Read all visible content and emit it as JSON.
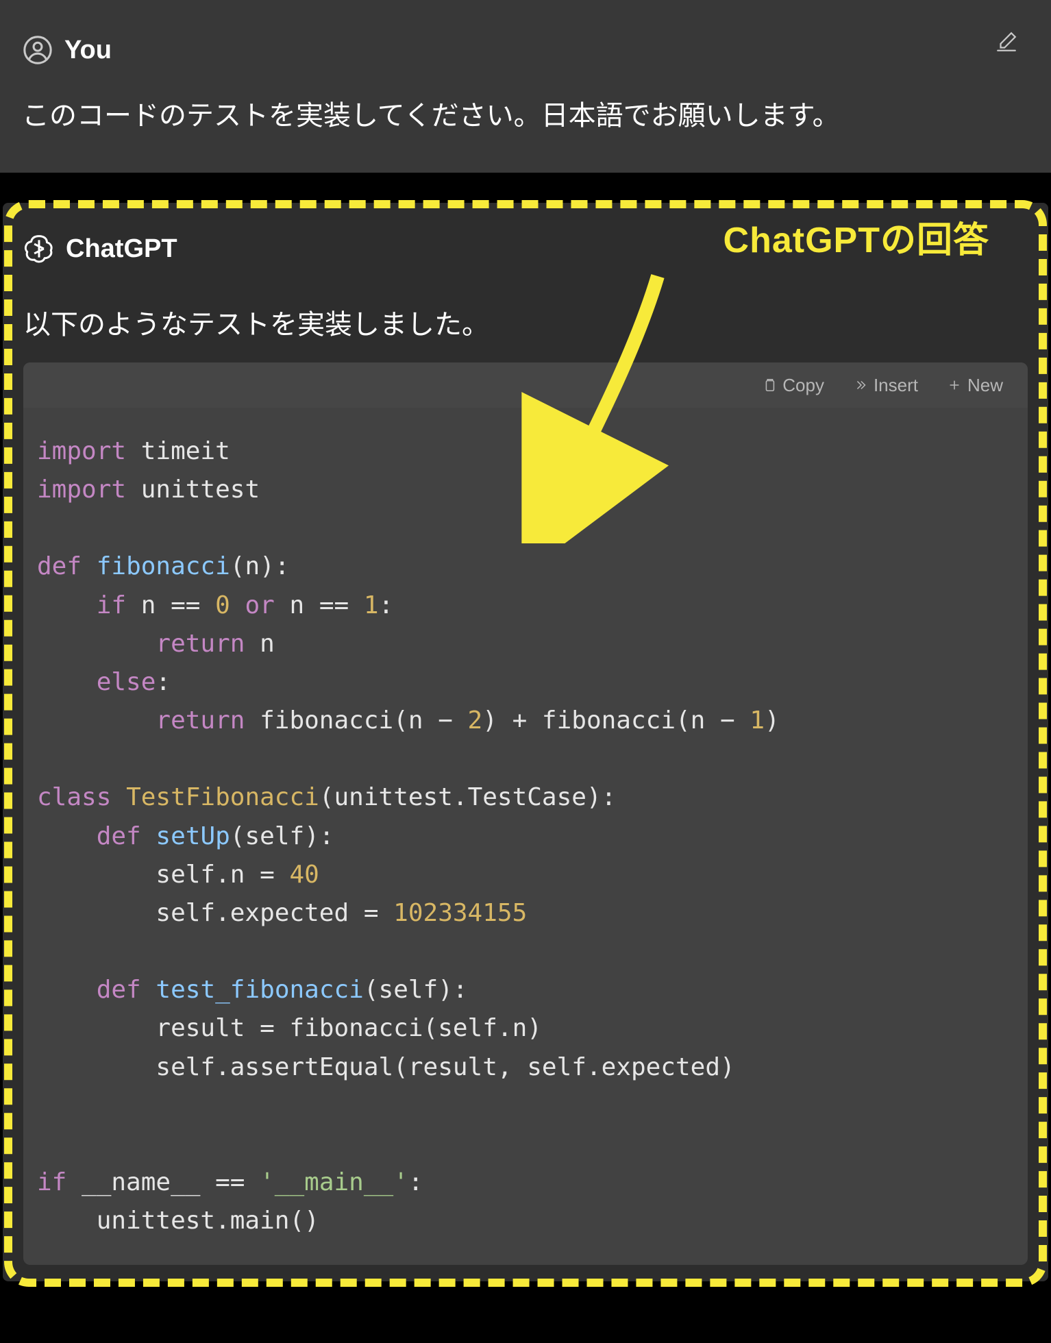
{
  "user": {
    "role": "You",
    "message": "このコードのテストを実装してください。日本語でお願いします。"
  },
  "assistant": {
    "role": "ChatGPT",
    "intro": "以下のようなテストを実装しました。"
  },
  "annotation": {
    "label": "ChatGPTの回答"
  },
  "toolbar": {
    "copy": "Copy",
    "insert": "Insert",
    "new": "New"
  },
  "code_tokens": [
    [
      [
        "kw",
        "import"
      ],
      [
        "p",
        " "
      ],
      [
        "id",
        "timeit"
      ]
    ],
    [
      [
        "kw",
        "import"
      ],
      [
        "p",
        " "
      ],
      [
        "id",
        "unittest"
      ]
    ],
    [],
    [
      [
        "kw",
        "def"
      ],
      [
        "p",
        " "
      ],
      [
        "fn",
        "fibonacci"
      ],
      [
        "p",
        "(n):"
      ]
    ],
    [
      [
        "p",
        "    "
      ],
      [
        "kw",
        "if"
      ],
      [
        "p",
        " n == "
      ],
      [
        "num",
        "0"
      ],
      [
        "p",
        " "
      ],
      [
        "kw",
        "or"
      ],
      [
        "p",
        " n == "
      ],
      [
        "num",
        "1"
      ],
      [
        "p",
        ":"
      ]
    ],
    [
      [
        "p",
        "        "
      ],
      [
        "kw",
        "return"
      ],
      [
        "p",
        " n"
      ]
    ],
    [
      [
        "p",
        "    "
      ],
      [
        "kw",
        "else"
      ],
      [
        "p",
        ":"
      ]
    ],
    [
      [
        "p",
        "        "
      ],
      [
        "kw",
        "return"
      ],
      [
        "p",
        " fibonacci(n − "
      ],
      [
        "num",
        "2"
      ],
      [
        "p",
        ") + fibonacci(n − "
      ],
      [
        "num",
        "1"
      ],
      [
        "p",
        ")"
      ]
    ],
    [],
    [
      [
        "kw",
        "class"
      ],
      [
        "p",
        " "
      ],
      [
        "cls",
        "TestFibonacci"
      ],
      [
        "p",
        "(unittest.TestCase):"
      ]
    ],
    [
      [
        "p",
        "    "
      ],
      [
        "kw",
        "def"
      ],
      [
        "p",
        " "
      ],
      [
        "fn",
        "setUp"
      ],
      [
        "p",
        "(self):"
      ]
    ],
    [
      [
        "p",
        "        self.n = "
      ],
      [
        "num",
        "40"
      ]
    ],
    [
      [
        "p",
        "        self.expected = "
      ],
      [
        "num",
        "102334155"
      ]
    ],
    [],
    [
      [
        "p",
        "    "
      ],
      [
        "kw",
        "def"
      ],
      [
        "p",
        " "
      ],
      [
        "fn",
        "test_fibonacci"
      ],
      [
        "p",
        "(self):"
      ]
    ],
    [
      [
        "p",
        "        result = fibonacci(self.n)"
      ]
    ],
    [
      [
        "p",
        "        self.assertEqual(result, self.expected)"
      ]
    ],
    [],
    [],
    [
      [
        "kw",
        "if"
      ],
      [
        "p",
        " __name__ == "
      ],
      [
        "str",
        "'__main__'"
      ],
      [
        "p",
        ":"
      ]
    ],
    [
      [
        "p",
        "    unittest.main()"
      ]
    ]
  ]
}
